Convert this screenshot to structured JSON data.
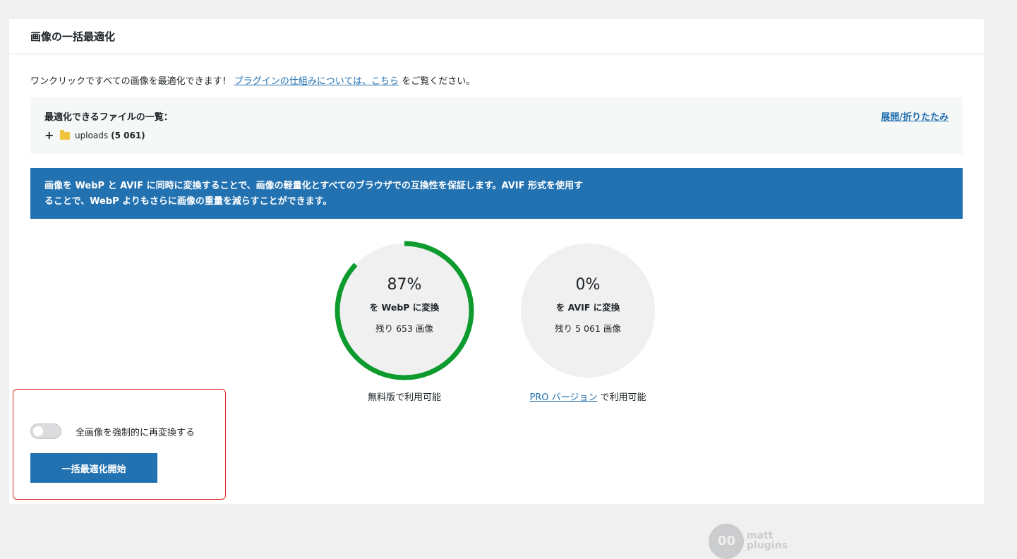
{
  "card": {
    "title": "画像の一括最適化"
  },
  "intro": {
    "text_before": "ワンクリックですべての画像を最適化できます！ ",
    "link": "プラグインの仕組みについては、こちら",
    "text_after": " をご覧ください。"
  },
  "files": {
    "title": "最適化できるファイルの一覧：",
    "toggle_link": "展開/折りたたみ",
    "tree": [
      {
        "expander": "+",
        "icon": "folder-icon",
        "name": "uploads",
        "count": "(5 061)"
      }
    ]
  },
  "notice": {
    "line1": "画像を WebP と AVIF に同時に変換することで、画像の軽量化とすべてのブラウザでの互換性を保証します。AVIF 形式を使用す",
    "line2": "ることで、WebP よりもさらに画像の重量を減らすことができます。"
  },
  "stats": [
    {
      "percent_text": "87%",
      "percent_value": 0.87,
      "label": "を WebP に変換",
      "remaining": "残り 653 画像",
      "availability_text": "無料版で利用可能",
      "progress_color": "#0d9b2e"
    },
    {
      "percent_text": "0%",
      "percent_value": 0,
      "label": "を AVIF に変換",
      "remaining": "残り 5 061 画像",
      "availability_link": "PRO バージョン",
      "availability_text": " で利用可能",
      "progress_color": "#0d9b2e"
    }
  ],
  "force": {
    "label": "全画像を強制的に再変換する",
    "checked": false
  },
  "start_button": {
    "label": "一括最適化開始"
  },
  "logo": {
    "line1": "matt",
    "line2": "plugins"
  },
  "colors": {
    "accent": "#2271b1",
    "highlight_border": "#e02424",
    "progress": "#0d9b2e"
  }
}
